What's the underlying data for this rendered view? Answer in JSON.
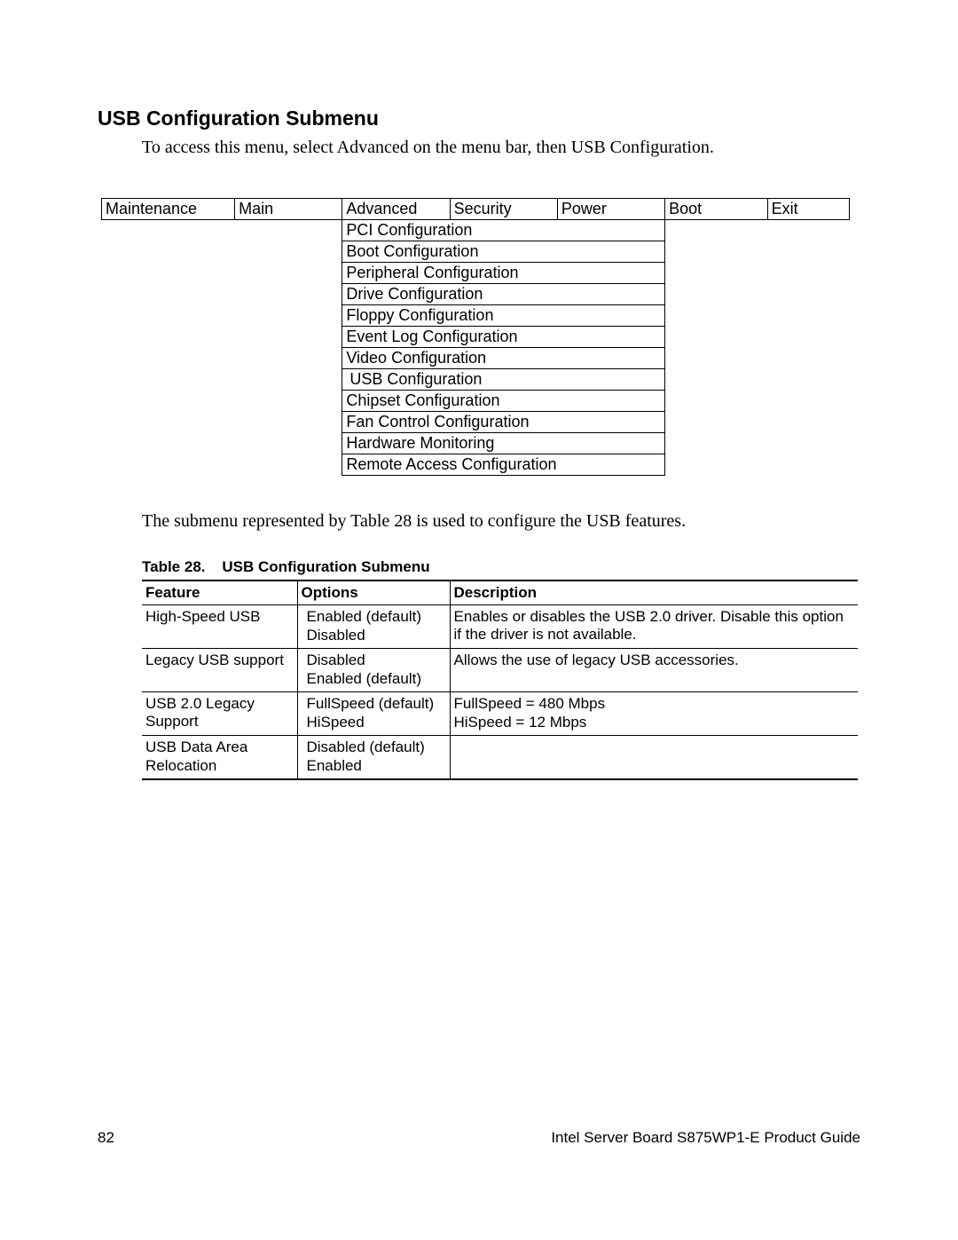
{
  "heading": "USB Configuration Submenu",
  "intro": "To access this menu, select Advanced on the menu bar, then USB Configuration.",
  "menu_bar": {
    "maintenance": "Maintenance",
    "main": "Main",
    "advanced": "Advanced",
    "security": "Security",
    "power": "Power",
    "boot": "Boot",
    "exit": "Exit"
  },
  "submenu_items": {
    "i0": "PCI Configuration",
    "i1": "Boot Configuration",
    "i2": "Peripheral Configuration",
    "i3": "Drive Configuration",
    "i4": "Floppy Configuration",
    "i5": "Event Log Configuration",
    "i6": "Video Configuration",
    "i7": "USB Configuration",
    "i8": "Chipset Configuration",
    "i9": "Fan Control Configuration",
    "i10": "Hardware Monitoring",
    "i11": "Remote Access Configuration"
  },
  "body_text": "The submenu represented by Table 28 is used to configure the USB features.",
  "table_caption_label": "Table 28.",
  "table_caption_title": "USB Configuration Submenu",
  "feature_table": {
    "headers": {
      "feature": "Feature",
      "options": "Options",
      "description": "Description"
    },
    "rows": {
      "r0": {
        "feature": "High-Speed USB",
        "opt1": "Enabled (default)",
        "opt2": "Disabled",
        "desc": "Enables or disables the USB 2.0 driver. Disable this option if the driver is not available."
      },
      "r1": {
        "feature": "Legacy USB support",
        "opt1": "Disabled",
        "opt2": "Enabled (default)",
        "desc": "Allows the use of legacy USB accessories."
      },
      "r2": {
        "feature": "USB 2.0 Legacy Support",
        "opt1": "FullSpeed (default)",
        "opt2": "HiSpeed",
        "desc1": "FullSpeed = 480 Mbps",
        "desc2": "HiSpeed = 12 Mbps"
      },
      "r3": {
        "feature_l1": "USB Data Area",
        "feature_l2": "Relocation",
        "opt1": "Disabled (default)",
        "opt2": "Enabled",
        "desc": ""
      }
    }
  },
  "footer": {
    "page": "82",
    "doc": "Intel Server Board S875WP1-E Product Guide"
  }
}
